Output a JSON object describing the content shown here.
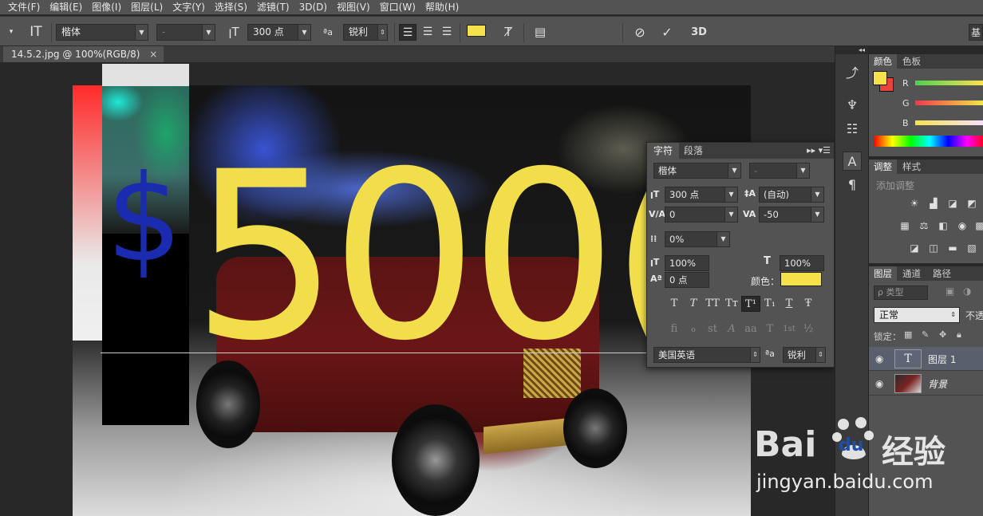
{
  "menu": [
    "文件(F)",
    "编辑(E)",
    "图像(I)",
    "图层(L)",
    "文字(Y)",
    "选择(S)",
    "滤镜(T)",
    "3D(D)",
    "视图(V)",
    "窗口(W)",
    "帮助(H)"
  ],
  "options": {
    "font_family": "楷体",
    "font_style": "-",
    "font_size": "300 点",
    "anti_alias": "锐利",
    "text_color": "#f5e24b",
    "three_d_label": "3D",
    "workspace_label": "基"
  },
  "document": {
    "tab_title": "14.5.2.jpg @ 100%(RGB/8)",
    "close_glyph": "×",
    "text_dollar": "$",
    "text_main": "500("
  },
  "character_panel": {
    "tab_char": "字符",
    "tab_para": "段落",
    "font_family": "楷体",
    "font_style": "-",
    "font_size": "300 点",
    "leading": "(自动)",
    "kerning": "0",
    "tracking": "-50",
    "tsume": "0%",
    "vertical_scale": "100%",
    "horizontal_scale": "100%",
    "baseline_shift": "0 点",
    "color_label": "颜色：",
    "color": "#f5e24b",
    "language": "美国英语",
    "anti_alias": "锐利",
    "aa_glyph": "ªa",
    "style_buttons": [
      "T",
      "T",
      "TT",
      "Tт",
      "T¹",
      "T₁",
      "T",
      "Ŧ"
    ],
    "opentype_buttons": [
      "fi",
      "ℴ",
      "st",
      "A",
      "aa",
      "T",
      "1st",
      "½"
    ]
  },
  "color_panel": {
    "tab_color": "颜色",
    "tab_swatches": "色板",
    "fg": "#f5e24b",
    "bg": "#e8423a",
    "r_label": "R",
    "g_label": "G",
    "b_label": "B"
  },
  "adjust_panel": {
    "tab_adjust": "调整",
    "tab_styles": "样式",
    "title": "添加调整"
  },
  "layers_panel": {
    "tab_layers": "图层",
    "tab_channels": "通道",
    "tab_paths": "路径",
    "filter": "ρ 类型",
    "blend_mode": "正常",
    "opacity_label": "不透",
    "lock_label": "锁定：",
    "layers": [
      {
        "name": "图层 1",
        "kind": "text",
        "thumb_glyph": "T"
      },
      {
        "name": "背景",
        "kind": "image"
      }
    ]
  },
  "watermark": {
    "brand_left": "Bai",
    "brand_mid": "du",
    "brand_right": "经验",
    "url": "jingyan.baidu.com"
  }
}
